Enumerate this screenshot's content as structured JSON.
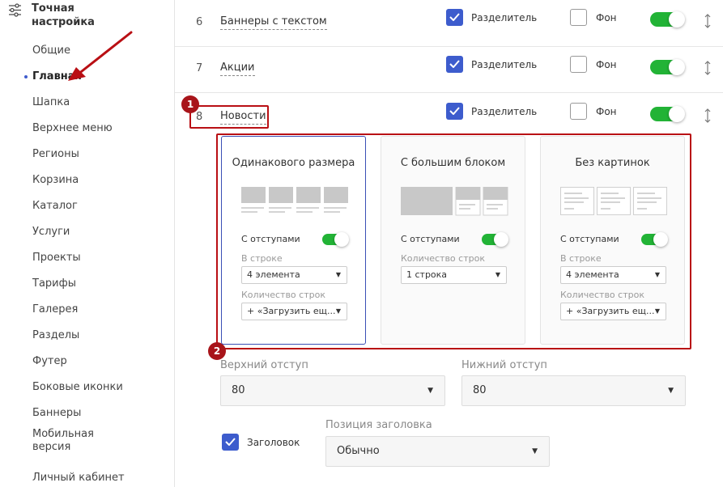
{
  "sidebar": {
    "title": "Точная настройка",
    "items": [
      {
        "label": "Общие"
      },
      {
        "label": "Главная",
        "active": true
      },
      {
        "label": "Шапка"
      },
      {
        "label": "Верхнее меню"
      },
      {
        "label": "Регионы"
      },
      {
        "label": "Корзина"
      },
      {
        "label": "Каталог"
      },
      {
        "label": "Услуги"
      },
      {
        "label": "Проекты"
      },
      {
        "label": "Тарифы"
      },
      {
        "label": "Галерея"
      },
      {
        "label": "Разделы"
      },
      {
        "label": "Футер"
      },
      {
        "label": "Боковые иконки"
      },
      {
        "label": "Баннеры"
      },
      {
        "label": "Мобильная версия"
      },
      {
        "label": "Личный кабинет"
      }
    ]
  },
  "rows": [
    {
      "num": "6",
      "name": "Баннеры с текстом",
      "divider_label": "Разделитель",
      "divider_checked": true,
      "bg_label": "Фон",
      "bg_checked": false,
      "enabled": true
    },
    {
      "num": "7",
      "name": "Акции",
      "divider_label": "Разделитель",
      "divider_checked": true,
      "bg_label": "Фон",
      "bg_checked": false,
      "enabled": true
    },
    {
      "num": "8",
      "name": "Новости",
      "divider_label": "Разделитель",
      "divider_checked": true,
      "bg_label": "Фон",
      "bg_checked": false,
      "enabled": true
    }
  ],
  "annotations": {
    "badge1": "1",
    "badge2": "2"
  },
  "cards": [
    {
      "title": "Одинакового размера",
      "selected": true,
      "padding_label": "С отступами",
      "padding_on": true,
      "per_row_label": "В строке",
      "per_row_value": "4 элемента",
      "rows_label": "Количество строк",
      "rows_value": "+ «Загрузить ещ..."
    },
    {
      "title": "С большим блоком",
      "selected": false,
      "padding_label": "С отступами",
      "padding_on": true,
      "rows_label": "Количество строк",
      "rows_value": "1 строка"
    },
    {
      "title": "Без картинок",
      "selected": false,
      "padding_label": "С отступами",
      "padding_on": true,
      "per_row_label": "В строке",
      "per_row_value": "4 элемента",
      "rows_label": "Количество строк",
      "rows_value": "+ «Загрузить ещ..."
    }
  ],
  "margins": {
    "top_label": "Верхний отступ",
    "top_value": "80",
    "bottom_label": "Нижний отступ",
    "bottom_value": "80"
  },
  "heading": {
    "checkbox_label": "Заголовок",
    "checked": true,
    "position_label": "Позиция заголовка",
    "position_value": "Обычно"
  },
  "colors": {
    "accent": "#3d5ccd",
    "toggle_on": "#22b336",
    "annotation": "#b90f14"
  }
}
